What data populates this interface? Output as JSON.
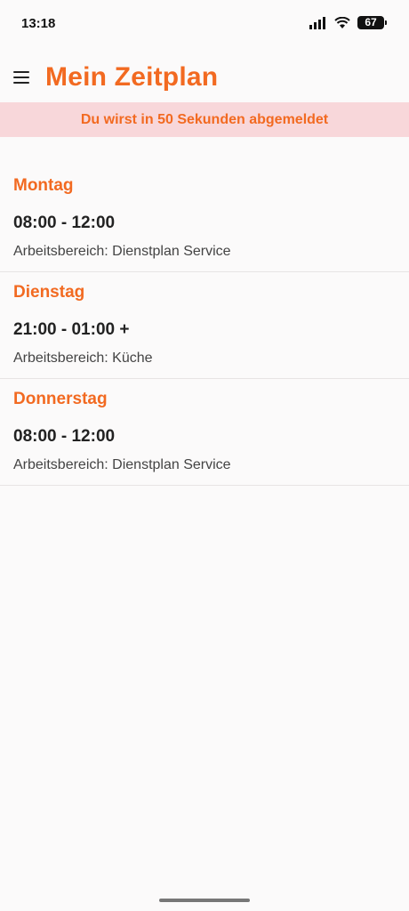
{
  "status_bar": {
    "time": "13:18",
    "battery": "67",
    "icons": [
      "signal-icon",
      "wifi-icon",
      "battery-icon"
    ]
  },
  "header": {
    "menu_icon": "hamburger-menu-icon",
    "title": "Mein Zeitplan"
  },
  "banner": {
    "text": "Du wirst in 50 Sekunden abgemeldet"
  },
  "schedule": [
    {
      "day": "Montag",
      "time": "08:00 - 12:00",
      "area": "Arbeitsbereich: Dienstplan Service"
    },
    {
      "day": "Dienstag",
      "time": "21:00 - 01:00 +",
      "area": "Arbeitsbereich: Küche"
    },
    {
      "day": "Donnerstag",
      "time": "08:00 - 12:00",
      "area": "Arbeitsbereich: Dienstplan Service"
    }
  ],
  "colors": {
    "accent": "#f26a21",
    "banner_background": "#f8d7da",
    "background": "#fbfafa"
  }
}
